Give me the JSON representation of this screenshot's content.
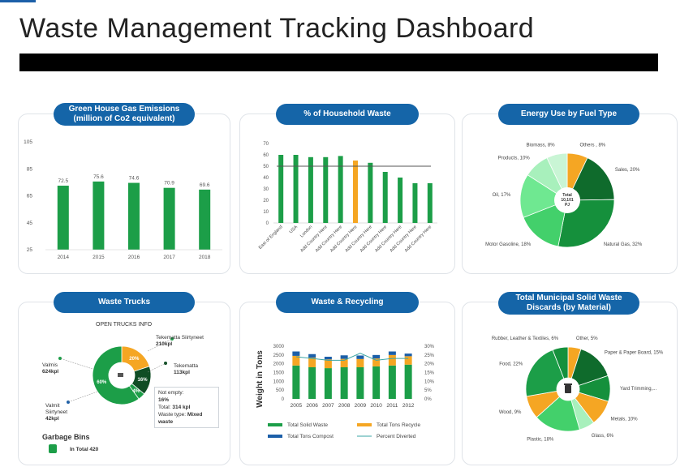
{
  "page": {
    "title": "Waste Management Tracking Dashboard"
  },
  "colors": {
    "pill": "#1565a8",
    "green": "#1c9e48",
    "orange": "#f5a623",
    "dark_blue": "#1c5fa8",
    "light_green": "#9ee8a8",
    "mid_green": "#43d06b",
    "dark_green": "#0f6b2c"
  },
  "panels": {
    "ghg": {
      "title": "Green House Gas Emissions (million of Co2 equivalent)"
    },
    "household": {
      "title": "% of Household Waste"
    },
    "energy": {
      "title": "Energy Use by Fuel Type"
    },
    "trucks": {
      "title": "Waste Trucks"
    },
    "recycling": {
      "title": "Waste & Recycling"
    },
    "municipal": {
      "title": "Total Municipal Solid Waste Discards (by Material)"
    }
  },
  "chart_data": [
    {
      "id": "ghg",
      "type": "bar",
      "title": "Green House Gas Emissions (million of Co2 equivalent)",
      "categories": [
        "2014",
        "2015",
        "2016",
        "2017",
        "2018"
      ],
      "values": [
        72.5,
        75.6,
        74.6,
        70.9,
        69.6
      ],
      "ylim": [
        25,
        105
      ],
      "yticks": [
        25,
        45,
        65,
        85,
        105
      ],
      "grid": false,
      "color": "#1c9e48"
    },
    {
      "id": "household",
      "type": "bar",
      "title": "% of Household Waste",
      "categories": [
        "East of England",
        "USA",
        "London",
        "Add Country Here",
        "Add Country Here",
        "Add Country Here",
        "Add Country Here",
        "Add Country Here",
        "Add Country Here",
        "Add Country Here",
        "Add Country Here"
      ],
      "values": [
        60,
        60,
        58,
        58,
        59,
        55,
        53,
        45,
        40,
        35,
        35
      ],
      "highlight_index": 5,
      "reference_line": 50,
      "ylim": [
        0,
        70
      ],
      "yticks": [
        0,
        10,
        20,
        30,
        40,
        50,
        60,
        70
      ],
      "colors": {
        "default": "#1c9e48",
        "highlight": "#f5a623",
        "line": "#555555"
      }
    },
    {
      "id": "energy",
      "type": "pie",
      "title": "Energy Use by Fuel Type",
      "center_label": [
        "Total",
        "10,101",
        "PJ"
      ],
      "slices": [
        {
          "label": "Others , 8%",
          "value": 8,
          "color": "#f5a623"
        },
        {
          "label": "Sales, 20%",
          "value": 20,
          "color": "#0f6b2c"
        },
        {
          "label": "Natural Gas, 32%",
          "value": 32,
          "color": "#15903c"
        },
        {
          "label": "Motor Gasoline, 18%",
          "value": 18,
          "color": "#43d06b"
        },
        {
          "label": "Oil, 17%",
          "value": 17,
          "color": "#6fe891"
        },
        {
          "label": "Products, 10%",
          "value": 10,
          "color": "#a8f0bc"
        },
        {
          "label": "Biomass, 8%",
          "value": 8,
          "color": "#c9f5d5"
        }
      ]
    },
    {
      "id": "trucks",
      "type": "pie",
      "title": "Waste Trucks",
      "subtitle": "OPEN TRUCKS INFO",
      "slices": [
        {
          "label": "20%",
          "value": 20,
          "color": "#f5a623"
        },
        {
          "label": "16%",
          "value": 16,
          "color": "#0f4d24"
        },
        {
          "label": "4%",
          "value": 4,
          "color": "#1c9e48"
        },
        {
          "label": "60%",
          "value": 60,
          "color": "#1c9e48"
        }
      ],
      "callouts": [
        {
          "name": "Tekematta Siirtyneet",
          "value": "210kpl"
        },
        {
          "name": "Tekematta",
          "value": "113kpl"
        },
        {
          "name": "Valmis",
          "value": "624kpl"
        },
        {
          "name": "Valmit Siirtyneet",
          "value": "42kpl"
        }
      ],
      "info_box": {
        "line1": "Not empty:",
        "line2": "16%",
        "line3_label": "Total:",
        "line3_value": "314 kpl",
        "line4_label": "Waste type:",
        "line4_value": "Mixed waste"
      },
      "garbage_bins": {
        "title": "Garbage Bins",
        "text": "In Total 420"
      }
    },
    {
      "id": "recycling",
      "type": "bar",
      "title": "Waste & Recycling",
      "ylabel": "Weight in Tons",
      "categories": [
        "2005",
        "2006",
        "2007",
        "2008",
        "2009",
        "2010",
        "2011",
        "2012"
      ],
      "series": [
        {
          "name": "Total Solid Waste",
          "values": [
            1900,
            1800,
            1750,
            1800,
            1800,
            1850,
            1900,
            1950
          ],
          "color": "#1c9e48"
        },
        {
          "name": "Total Tons Recycle",
          "values": [
            550,
            550,
            500,
            480,
            470,
            450,
            600,
            480
          ],
          "color": "#f5a623"
        },
        {
          "name": "Total Tons Compost",
          "values": [
            250,
            200,
            150,
            200,
            200,
            200,
            200,
            150
          ],
          "color": "#1c5fa8"
        },
        {
          "name": "Percent Diverted",
          "values": [
            24,
            23,
            22,
            22,
            26,
            22,
            23,
            23
          ],
          "color": "#3aa5a5",
          "axis": "right"
        }
      ],
      "ylim": [
        0,
        3000
      ],
      "yticks": [
        0,
        500,
        1000,
        1500,
        2000,
        2500,
        3000
      ],
      "y2lim": [
        0,
        30
      ],
      "y2ticks": [
        "0%",
        "5%",
        "10%",
        "15%",
        "20%",
        "25%",
        "30%"
      ]
    },
    {
      "id": "municipal",
      "type": "pie",
      "title": "Total Municipal Solid Waste Discards (by Material)",
      "slices": [
        {
          "label": "Other, 5%",
          "value": 5,
          "color": "#f5a623"
        },
        {
          "label": "Paper & Paper Board, 15%",
          "value": 15,
          "color": "#0f6b2c"
        },
        {
          "label": "Yard Trimming,...",
          "value": 10,
          "color": "#15903c"
        },
        {
          "label": "Metals, 10%",
          "value": 10,
          "color": "#f5a623"
        },
        {
          "label": "Glass, 6%",
          "value": 6,
          "color": "#a8f0bc"
        },
        {
          "label": "Plastic, 18%",
          "value": 18,
          "color": "#43d06b"
        },
        {
          "label": "Wood, 9%",
          "value": 9,
          "color": "#f5a623"
        },
        {
          "label": "Food, 22%",
          "value": 22,
          "color": "#1c9e48"
        },
        {
          "label": "Rubber, Leather & Textiles, 6%",
          "value": 6,
          "color": "#15903c"
        }
      ]
    }
  ]
}
